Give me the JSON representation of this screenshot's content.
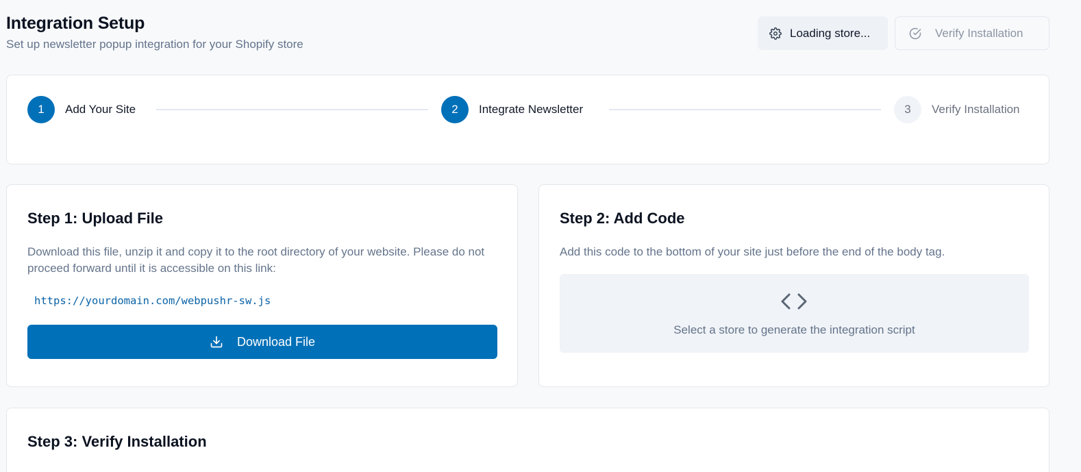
{
  "header": {
    "title": "Integration Setup",
    "subtitle": "Set up newsletter popup integration for your Shopify store"
  },
  "actions": {
    "store_label": "Loading store...",
    "store_icon": "gear-icon",
    "verify_label": "Verify Installation",
    "verify_icon": "check-circle-icon"
  },
  "stepper": {
    "steps": [
      {
        "number": "1",
        "label": "Add Your Site",
        "state": "active"
      },
      {
        "number": "2",
        "label": "Integrate Newsletter",
        "state": "active"
      },
      {
        "number": "3",
        "label": "Verify Installation",
        "state": "pending"
      }
    ]
  },
  "step1": {
    "title": "Step 1: Upload File",
    "description": "Download this file, unzip it and copy it to the root directory of your website. Please do not proceed forward until it is accessible on this link:",
    "link": "https://yourdomain.com/webpushr-sw.js",
    "download_label": "Download File",
    "download_icon": "download-icon"
  },
  "step2": {
    "title": "Step 2: Add Code",
    "description": "Add this code to the bottom of your site just before the end of the body tag.",
    "placeholder": "Select a store to generate the integration script",
    "placeholder_icon": "code-icon"
  },
  "step3": {
    "title": "Step 3: Verify Installation"
  },
  "colors": {
    "primary": "#0070b8",
    "background": "#f8f9fb",
    "muted_text": "#64748b",
    "border": "#e3e7ec"
  }
}
